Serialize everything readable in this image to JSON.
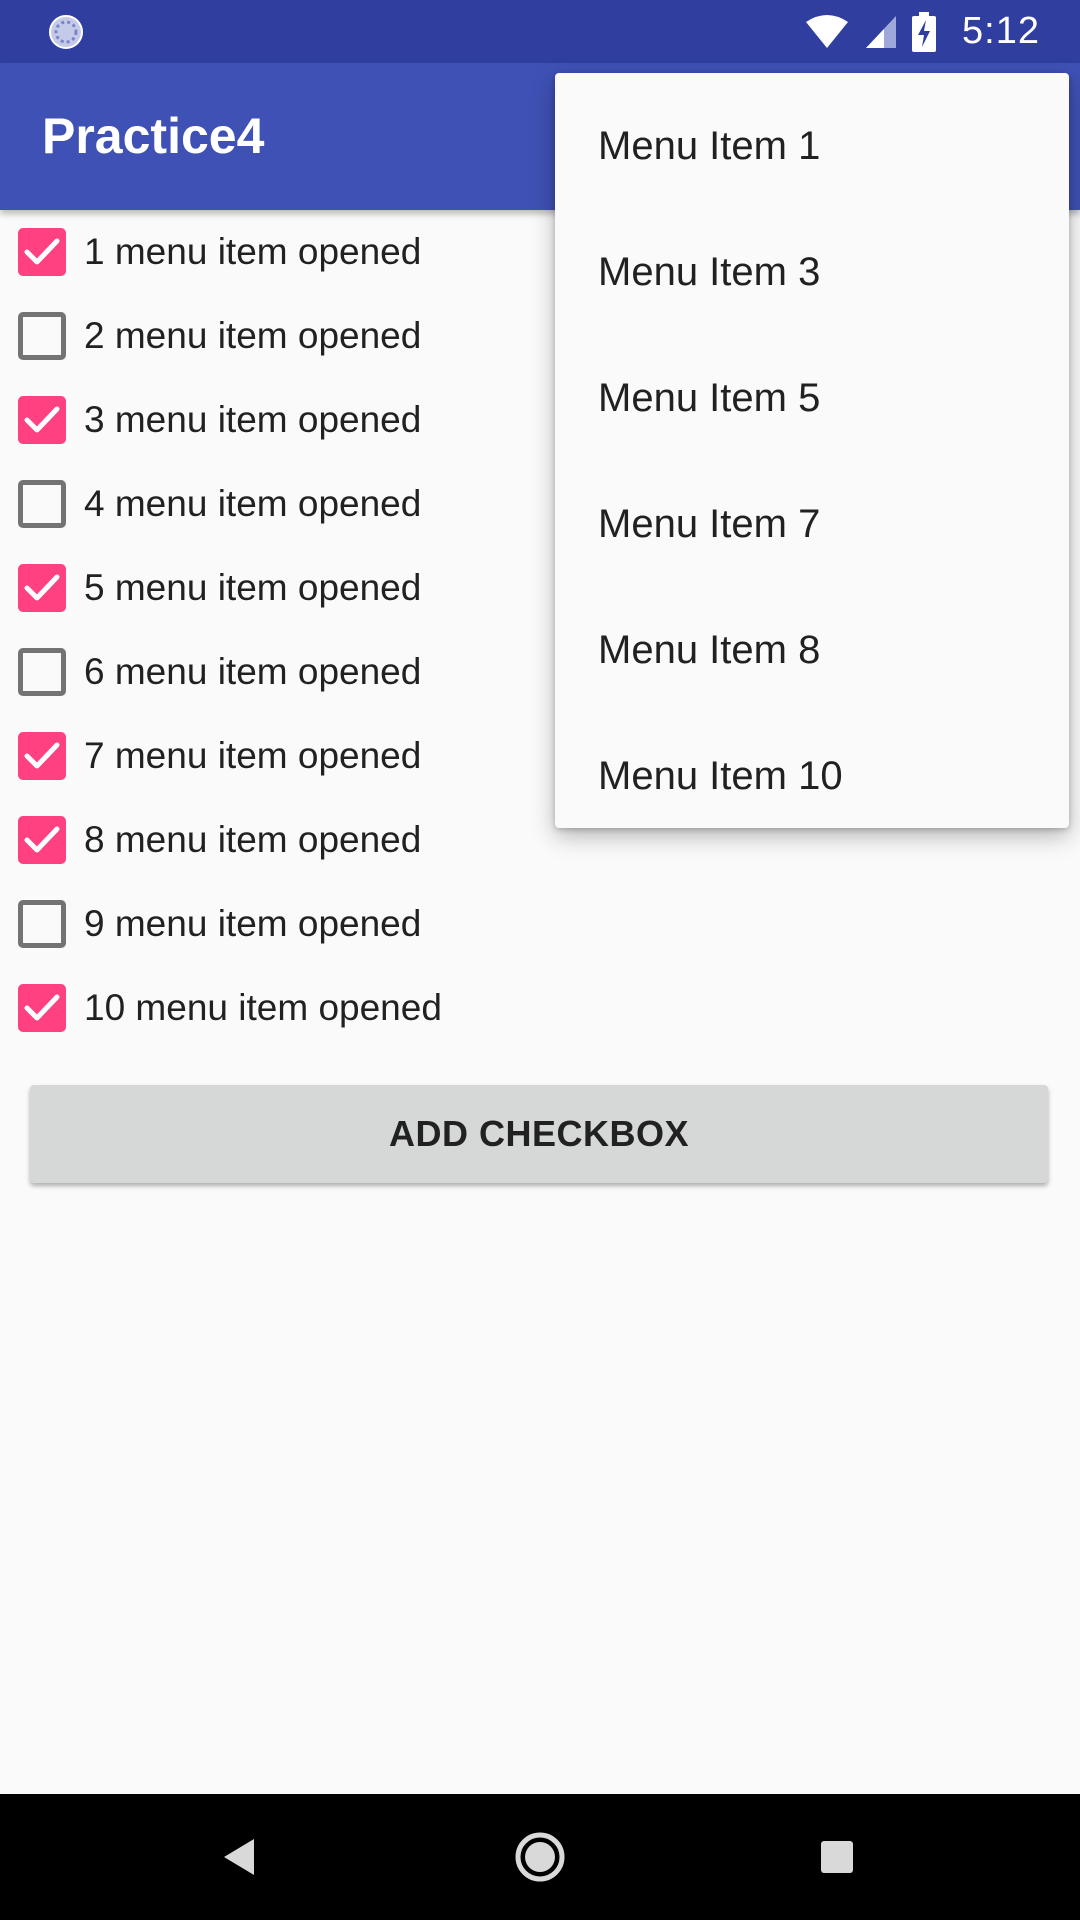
{
  "status_bar": {
    "time": "5:12",
    "left_icon": "sync-circle-icon",
    "icons": [
      "wifi-icon",
      "cell-signal-icon",
      "battery-charging-icon"
    ]
  },
  "app_bar": {
    "title": "Practice4"
  },
  "checkboxes": [
    {
      "label": "1 menu item opened",
      "checked": true
    },
    {
      "label": "2 menu item opened",
      "checked": false
    },
    {
      "label": "3 menu item opened",
      "checked": true
    },
    {
      "label": "4 menu item opened",
      "checked": false
    },
    {
      "label": "5 menu item opened",
      "checked": true
    },
    {
      "label": "6 menu item opened",
      "checked": false
    },
    {
      "label": "7 menu item opened",
      "checked": true
    },
    {
      "label": "8 menu item opened",
      "checked": true
    },
    {
      "label": "9 menu item opened",
      "checked": false
    },
    {
      "label": "10 menu item opened",
      "checked": true
    }
  ],
  "add_button": {
    "label": "ADD CHECKBOX"
  },
  "overflow_menu": {
    "items": [
      {
        "label": "Menu Item 1"
      },
      {
        "label": "Menu Item 3"
      },
      {
        "label": "Menu Item 5"
      },
      {
        "label": "Menu Item 7"
      },
      {
        "label": "Menu Item 8"
      },
      {
        "label": "Menu Item 10"
      }
    ]
  },
  "nav_bar": {
    "buttons": [
      "back-icon",
      "home-icon",
      "recents-icon"
    ]
  },
  "colors": {
    "status_bar": "#303f9f",
    "app_bar": "#3f51b5",
    "accent": "#ff4081",
    "background": "#fafafa"
  }
}
